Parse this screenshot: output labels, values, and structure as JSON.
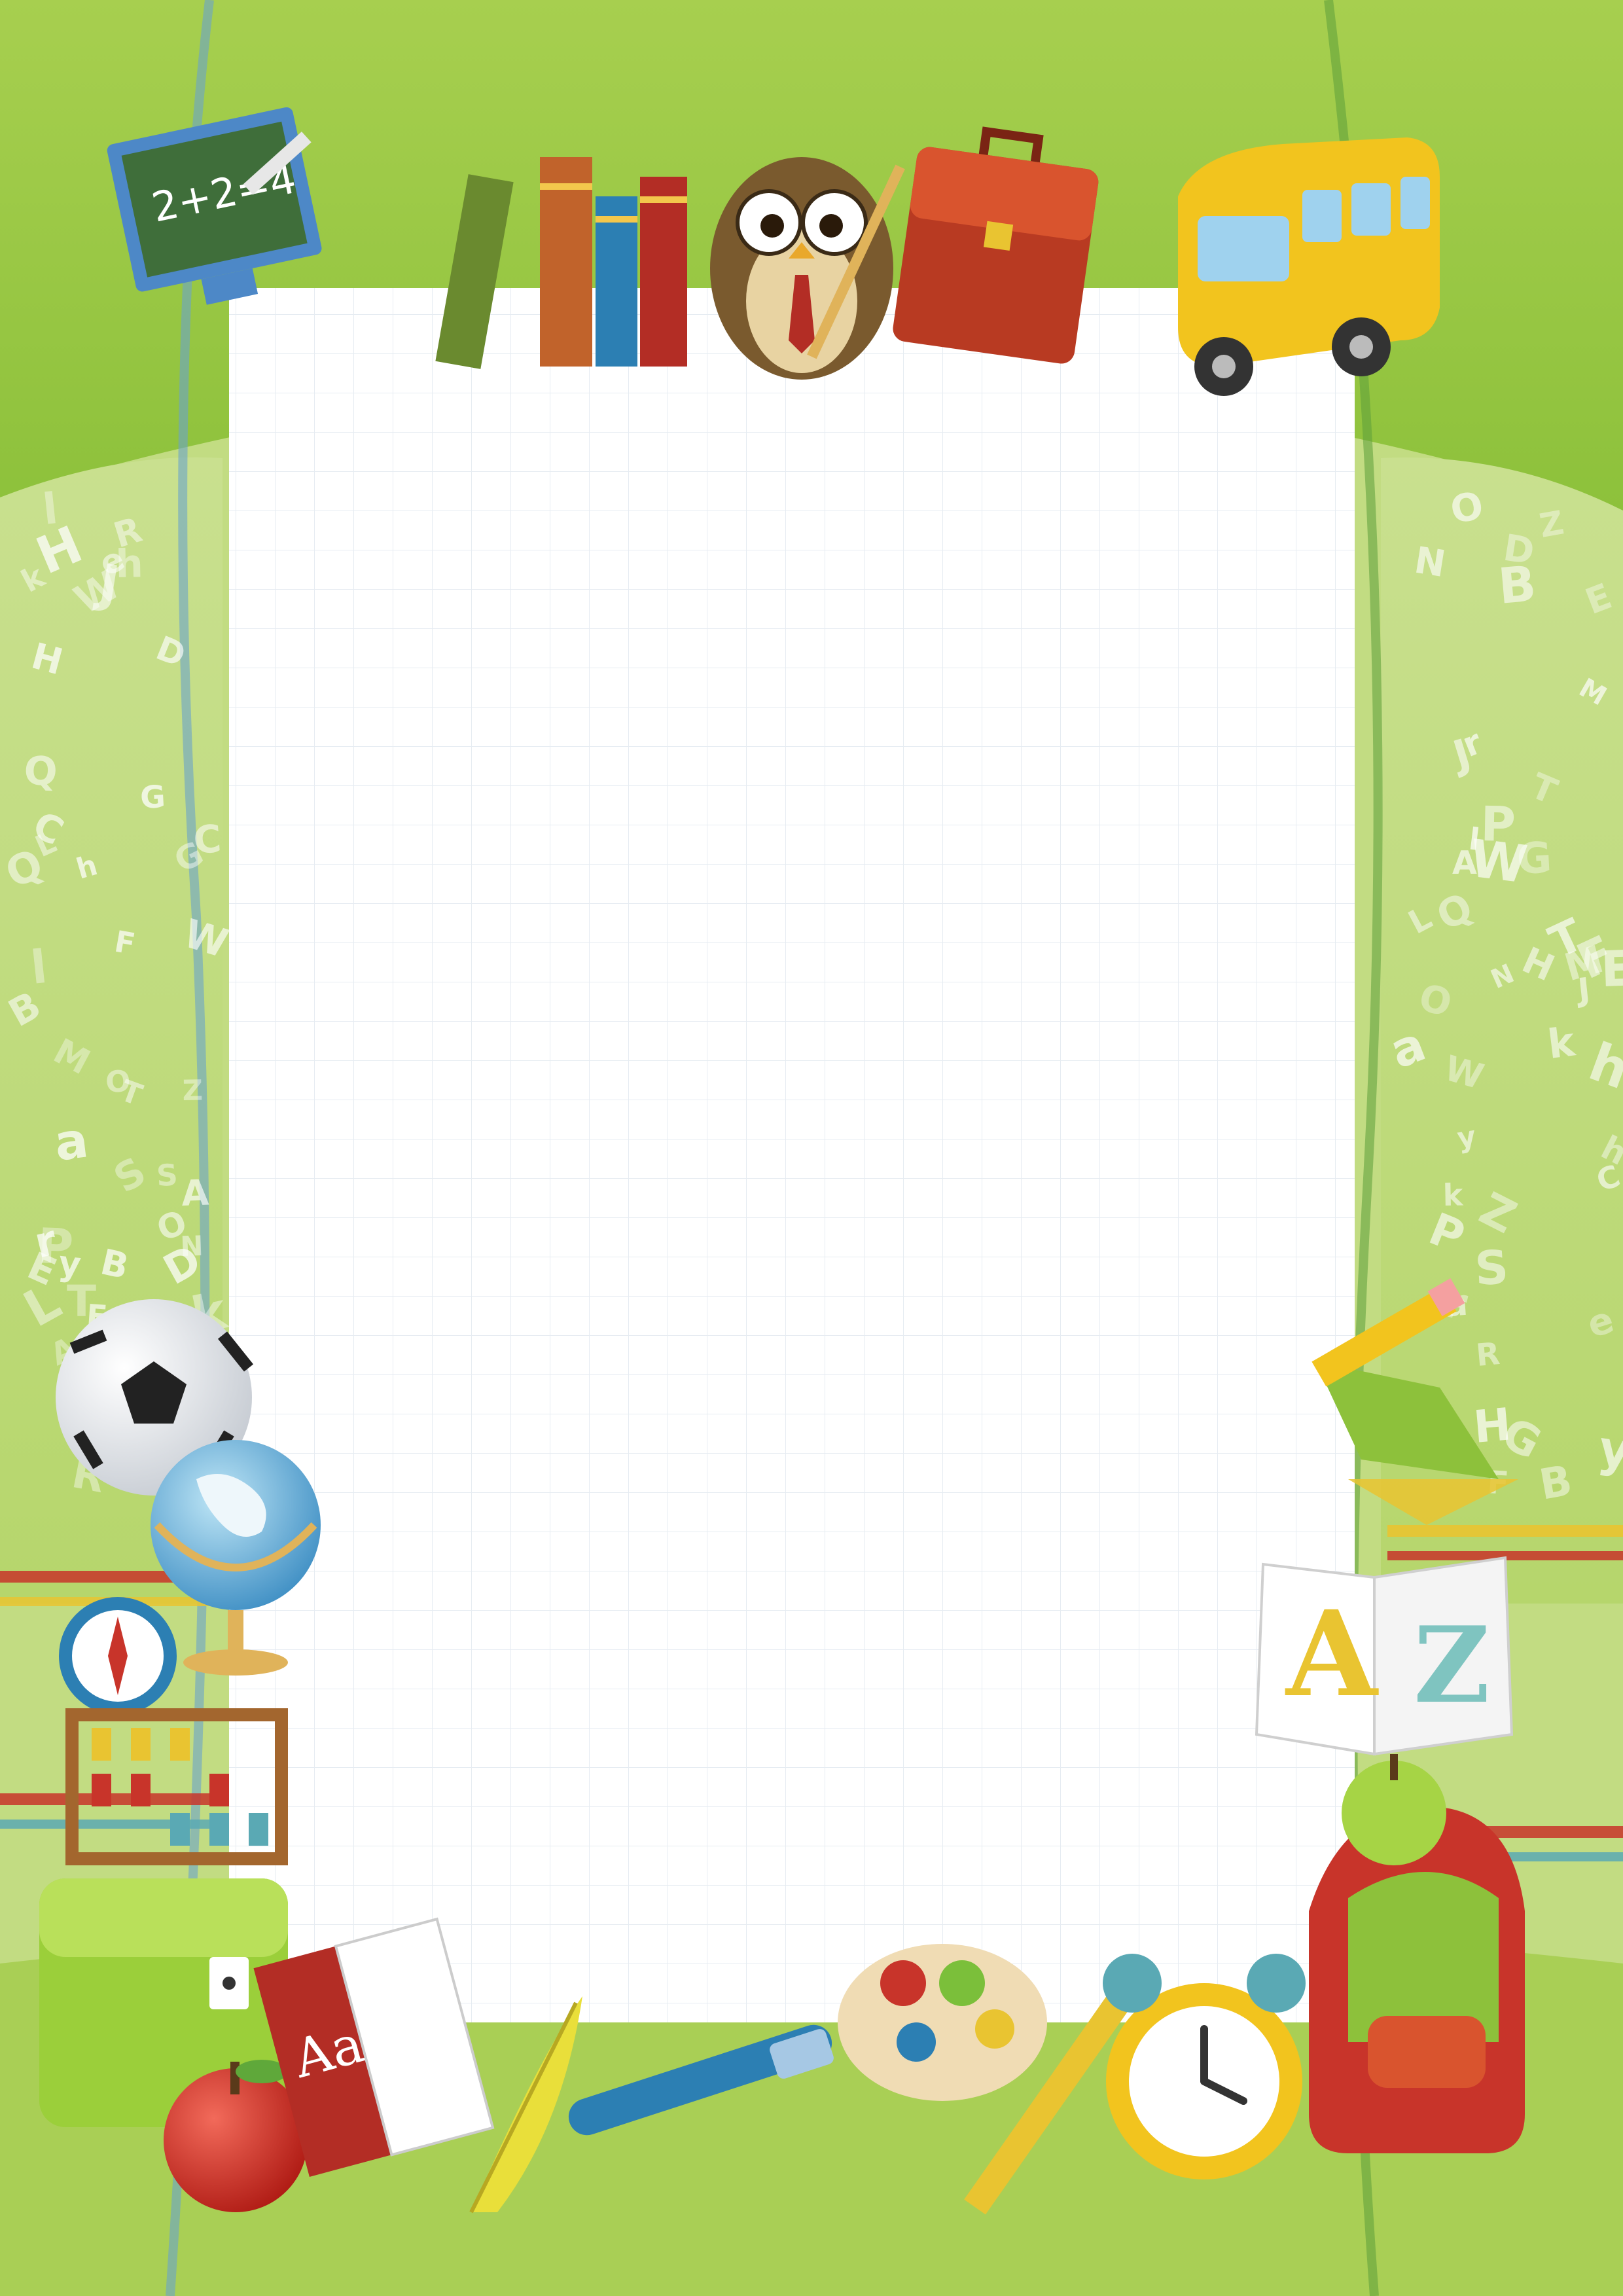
{
  "colors": {
    "leaf_green": "#8dc13b",
    "pale_green": "#cfe3a0",
    "paper": "#ffffff",
    "grid_line": "#e6ecf2",
    "stripe_red": "#c8342a",
    "stripe_yellow": "#e9c431",
    "stripe_teal": "#5aa9b4"
  },
  "background_letters": [
    "O",
    "B",
    "T",
    "k",
    "H",
    "F",
    "G",
    "W",
    "h",
    "J",
    "S",
    "N",
    "C",
    "M",
    "D",
    "y",
    "R",
    "Z",
    "Q",
    "E",
    "L",
    "P",
    "A",
    "a",
    "e",
    "r",
    "l"
  ],
  "chalkboard": {
    "text": "2+2=4"
  },
  "book_spine": {
    "text": "Aa"
  },
  "alphabet_book": {
    "letter_left": "A",
    "letter_right": "Z"
  },
  "icons": [
    "chalkboard-icon",
    "books-icon",
    "owl-icon",
    "briefcase-icon",
    "school-bus-icon",
    "soccer-ball-icon",
    "globe-icon",
    "compass-icon",
    "abacus-icon",
    "satchel-icon",
    "apple-icon",
    "pencil-icon",
    "notebook-icon",
    "ruler-icon",
    "backpack-icon",
    "alarm-clock-icon",
    "paint-palette-icon",
    "pen-icon",
    "feather-icon"
  ]
}
